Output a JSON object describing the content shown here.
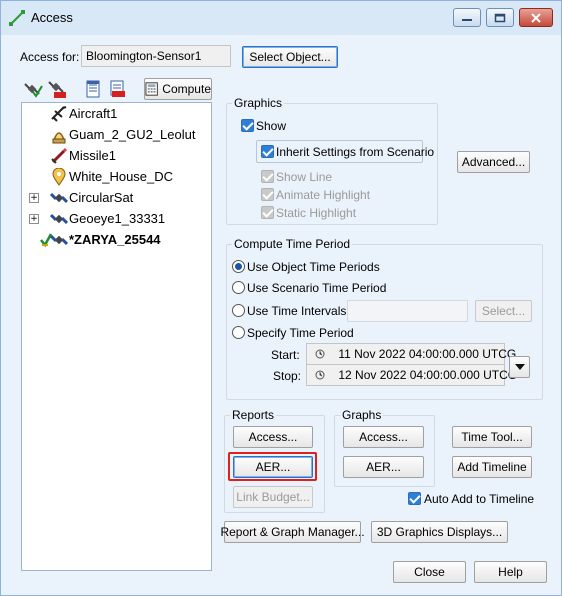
{
  "window": {
    "title": "Access",
    "controls": [
      "minimize-icon",
      "maximize-icon",
      "close-icon"
    ]
  },
  "access_for": {
    "label": "Access for:",
    "value": "Bloomington-Sensor1",
    "select_object": "Select Object..."
  },
  "toolbar": {
    "compute_label": "Compute"
  },
  "tree": {
    "items": [
      {
        "label": "Aircraft1",
        "icon": "aircraft-icon",
        "expandable": false,
        "bold": false
      },
      {
        "label": "Guam_2_GU2_Leolut",
        "icon": "facility-icon",
        "expandable": false,
        "bold": false
      },
      {
        "label": "Missile1",
        "icon": "missile-icon",
        "expandable": false,
        "bold": false
      },
      {
        "label": "White_House_DC",
        "icon": "place-icon",
        "expandable": false,
        "bold": false
      },
      {
        "label": "CircularSat",
        "icon": "satellite-icon",
        "expandable": true,
        "bold": false
      },
      {
        "label": "Geoeye1_33331",
        "icon": "satellite-icon",
        "expandable": true,
        "bold": false
      },
      {
        "label": "*ZARYA_25544",
        "icon": "satellite-icon",
        "expandable": false,
        "bold": true
      }
    ]
  },
  "graphics": {
    "title": "Graphics",
    "show": "Show",
    "inherit": "Inherit Settings from Scenario",
    "show_line": "Show Line",
    "animate_highlight": "Animate Highlight",
    "static_highlight": "Static Highlight",
    "advanced": "Advanced..."
  },
  "compute_time": {
    "title": "Compute Time Period",
    "use_object": "Use Object Time Periods",
    "use_scenario": "Use Scenario Time Period",
    "use_intervals": "Use Time Intervals",
    "select": "Select...",
    "specify": "Specify Time Period",
    "start_label": "Start:",
    "start_value": "11 Nov 2022 04:00:00.000 UTCG",
    "stop_label": "Stop:",
    "stop_value": "12 Nov 2022 04:00:00.000 UTCG"
  },
  "reports": {
    "title": "Reports",
    "access": "Access...",
    "aer": "AER...",
    "link_budget": "Link Budget..."
  },
  "graphs": {
    "title": "Graphs",
    "access": "Access...",
    "aer": "AER..."
  },
  "side_buttons": {
    "time_tool": "Time Tool...",
    "add_timeline": "Add Timeline",
    "auto_add": "Auto Add to Timeline"
  },
  "bottom": {
    "report_graph_manager": "Report & Graph Manager...",
    "graphics_3d": "3D Graphics Displays...",
    "close": "Close",
    "help": "Help"
  },
  "colors": {
    "window_bg": "#eaf2fb",
    "titlebar_bg": "#d9e8f7",
    "accent": "#2e7fd6",
    "highlight": "#e0201a"
  }
}
